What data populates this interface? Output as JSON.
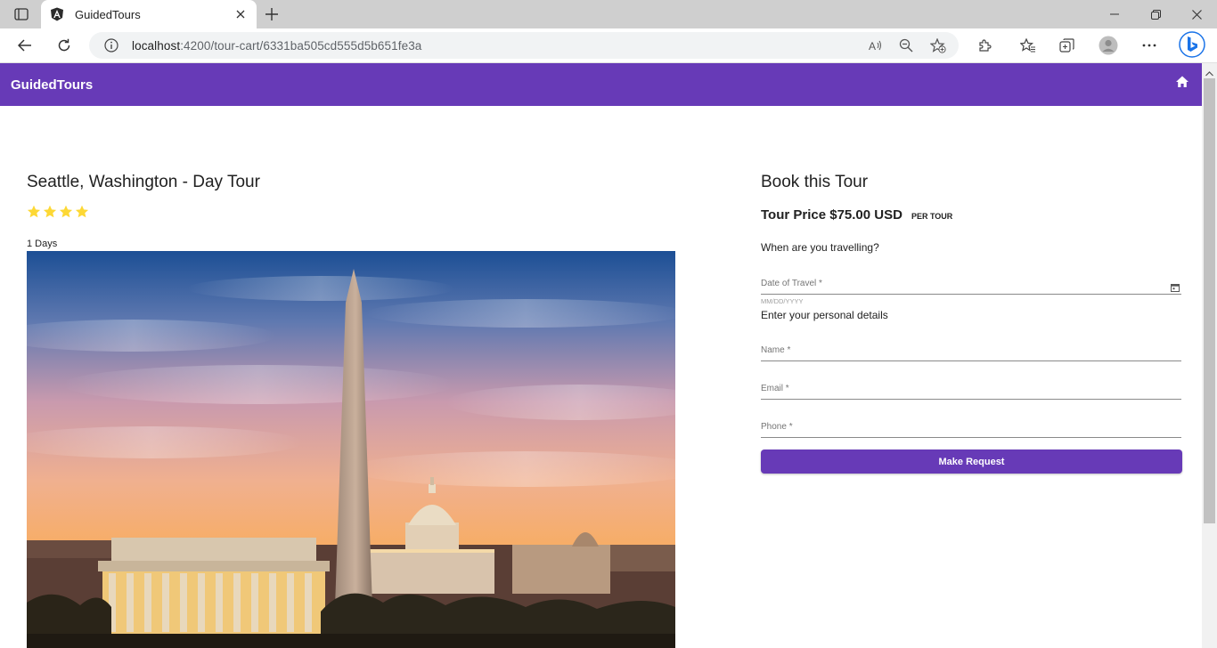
{
  "browser": {
    "tab_title": "GuidedTours",
    "url_host": "localhost",
    "url_path": ":4200/tour-cart/6331ba505cd555d5b651fe3a"
  },
  "app": {
    "brand": "GuidedTours"
  },
  "tour": {
    "title": "Seattle, Washington - Day Tour",
    "rating": 4,
    "duration": "1 Days"
  },
  "booking": {
    "heading": "Book this Tour",
    "price": "Tour Price $75.00 USD",
    "price_unit": "PER TOUR",
    "travel_question": "When are you travelling?",
    "date_label": "Date of Travel *",
    "date_hint": "MM/DD/YYYY",
    "personal_heading": "Enter your personal details",
    "name_label": "Name *",
    "email_label": "Email *",
    "phone_label": "Phone *",
    "submit_label": "Make Request"
  },
  "colors": {
    "primary": "#673ab7",
    "star": "#fdd835"
  }
}
